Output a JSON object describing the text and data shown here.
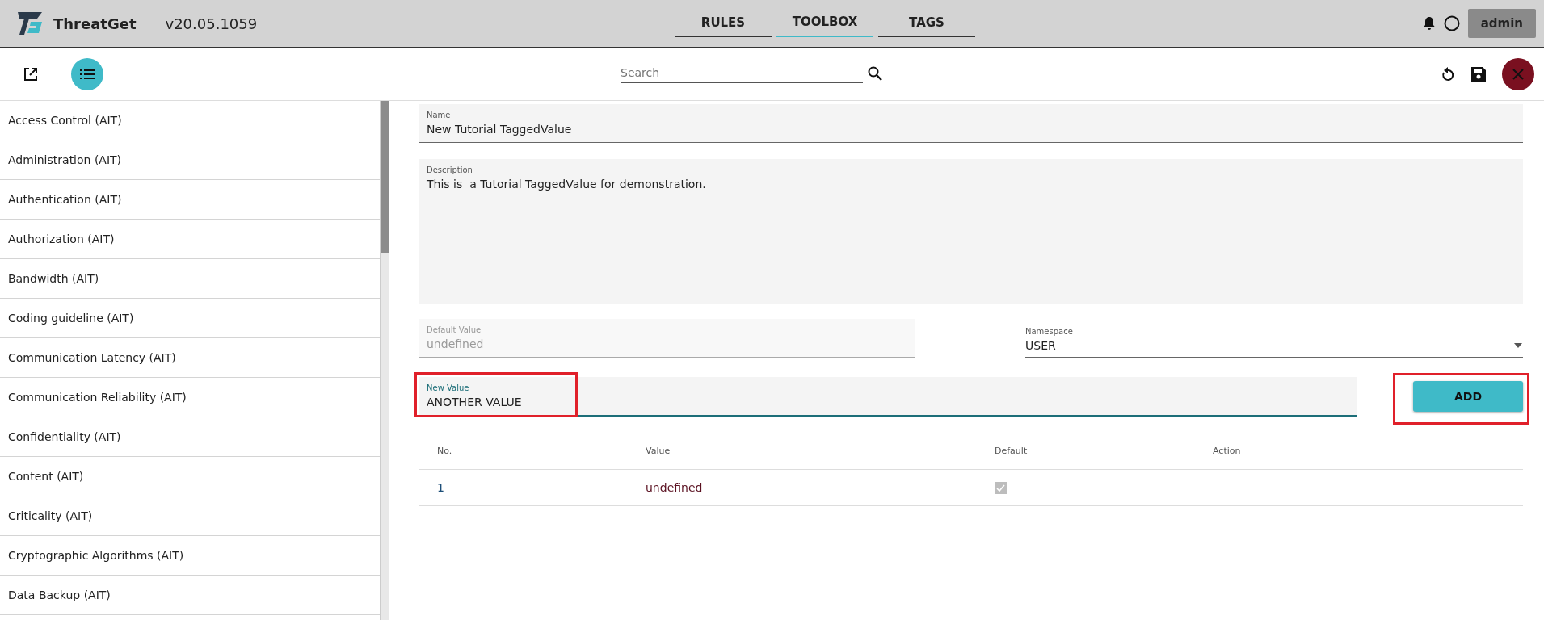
{
  "header": {
    "app_name": "ThreatGet",
    "version": "v20.05.1059",
    "tabs": [
      {
        "label": "RULES",
        "selected": false
      },
      {
        "label": "TOOLBOX",
        "selected": true
      },
      {
        "label": "TAGS",
        "selected": false
      }
    ],
    "user": "admin"
  },
  "toolbar": {
    "search": {
      "placeholder": "Search"
    },
    "list_view": {
      "selected": true
    }
  },
  "sidebar": {
    "items": [
      "Access Control (AIT)",
      "Administration (AIT)",
      "Authentication (AIT)",
      "Authorization (AIT)",
      "Bandwidth (AIT)",
      "Coding guideline (AIT)",
      "Communication Latency (AIT)",
      "Communication Reliability (AIT)",
      "Confidentiality (AIT)",
      "Content (AIT)",
      "Criticality (AIT)",
      "Cryptographic Algorithms (AIT)",
      "Data Backup (AIT)"
    ]
  },
  "form": {
    "name": {
      "label": "Name",
      "value": "New Tutorial TaggedValue"
    },
    "description": {
      "label": "Description",
      "value": "This is  a Tutorial TaggedValue for demonstration."
    },
    "default_value": {
      "label": "Default Value",
      "value": "undefined",
      "disabled": true
    },
    "namespace": {
      "label": "Namespace",
      "value": "USER"
    },
    "new_value": {
      "label": "New Value",
      "value": "ANOTHER VALUE",
      "focused": true,
      "highlighted": true
    },
    "add_button": {
      "label": "ADD",
      "highlighted": true
    }
  },
  "table": {
    "columns": [
      "No.",
      "Value",
      "Default",
      "Action"
    ],
    "rows": [
      {
        "no": "1",
        "value": "undefined",
        "default": true
      }
    ]
  }
}
